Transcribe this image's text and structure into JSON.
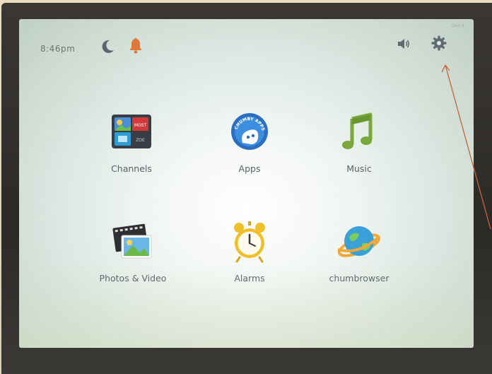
{
  "status_bar": {
    "time": "8:46pm",
    "tiny_label": "Gen 4"
  },
  "apps": [
    {
      "label": "Channels",
      "icon": "channels-icon"
    },
    {
      "label": "Apps",
      "icon": "apps-icon",
      "badge_text": "CHUMBY APPS"
    },
    {
      "label": "Music",
      "icon": "music-note-icon"
    },
    {
      "label": "Photos & Video",
      "icon": "photos-video-icon"
    },
    {
      "label": "Alarms",
      "icon": "alarm-clock-icon"
    },
    {
      "label": "chumbrowser",
      "icon": "globe-icon"
    }
  ],
  "channels_tiles": [
    "MOST",
    "ZOE"
  ],
  "colors": {
    "accent_bell": "#e0783a",
    "music_green": "#7aa83a",
    "alarm_yellow": "#f0c02a",
    "globe_blue": "#3aa0d8",
    "label_text": "#55606a",
    "arrow": "#c8643a"
  }
}
